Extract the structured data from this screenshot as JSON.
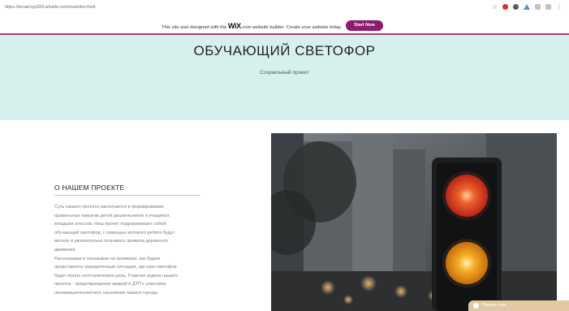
{
  "browser": {
    "url": "https://kovarnyp333.wixsite.com/svetoforchick",
    "icons": [
      "star-icon",
      "opera-icon",
      "account-icon",
      "extension-icon",
      "sync-icon",
      "puzzle-icon",
      "menu-icon"
    ]
  },
  "wix_banner": {
    "text_before": "This site was designed with the ",
    "logo": "WiX",
    "text_after": ".com website builder. Create your website today.",
    "button_label": "Start Now",
    "button_color": "#8f1a6e"
  },
  "hero": {
    "title": "ОБУЧАЮЩИЙ СВЕТОФОР",
    "subtitle": "Социальный проект",
    "background": "#d6f0ee"
  },
  "about": {
    "heading": "О НАШЕМ ПРОЕКТЕ",
    "lines": [
      "Суть нашего проекта заключается в формировании",
      "правильных навыков детей дошкольников и учащихся",
      "младших классов. Наш проект подразумевает собой",
      "обучающий светофор, с помощью которого ребята будут",
      "весело и увлекательно познавать правила дорожного",
      "движения.",
      "Рассказывая и показывая на примерах, мы будем",
      "представлять определенные ситуации, где наш светофор",
      "будет играть неотъемлемую роль. Главная задача нашего",
      "проекта - предотвращение аварий и ДТП с участием",
      "несовершеннолетнего населения нашего города."
    ]
  },
  "photo": {
    "subject": "traffic-light-photo",
    "colors": {
      "red_light": "#e8452a",
      "amber_light": "#f2a21c"
    }
  },
  "chat": {
    "label": "Пишите нам",
    "color": "#e2c8a3"
  }
}
